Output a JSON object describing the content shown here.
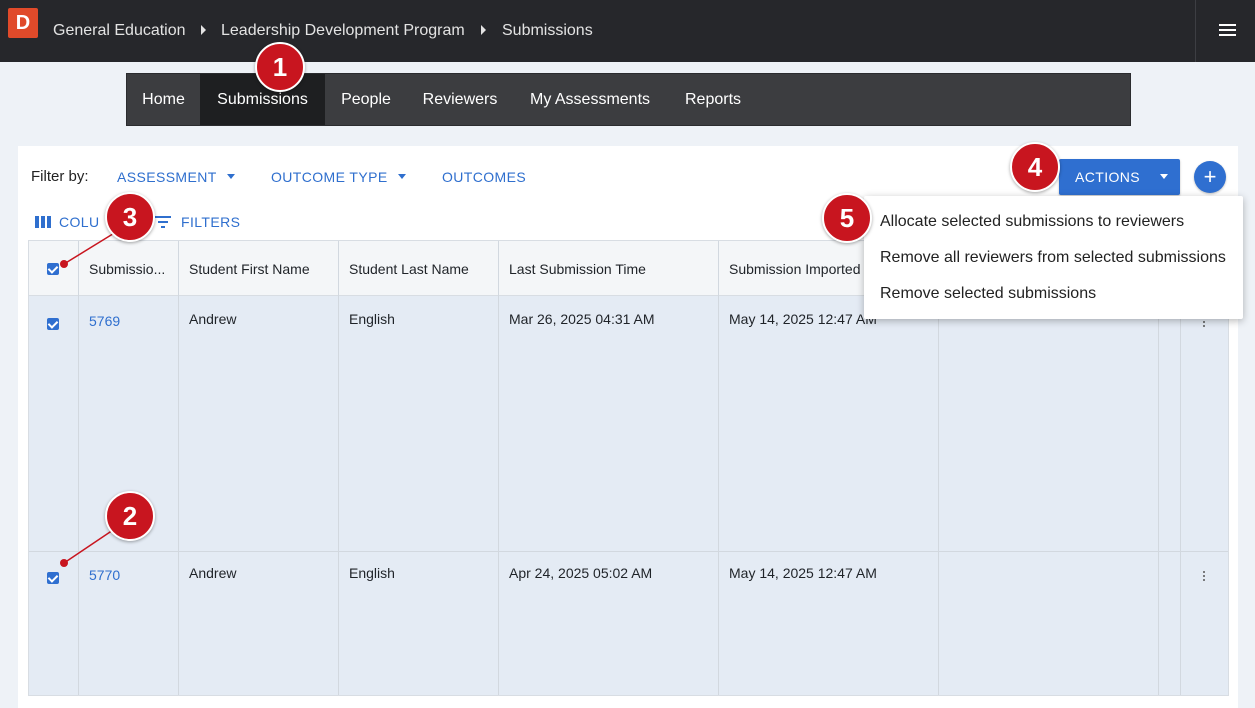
{
  "logo": "D",
  "breadcrumb": [
    "General Education",
    "Leadership Development Program",
    "Submissions"
  ],
  "nav": [
    "Home",
    "Submissions",
    "People",
    "Reviewers",
    "My Assessments",
    "Reports"
  ],
  "filters": {
    "label": "Filter by:",
    "assessment": "ASSESSMENT",
    "outcome_type": "OUTCOME TYPE",
    "outcomes": "OUTCOMES"
  },
  "toolbar": {
    "columns": "COLU",
    "filters": "FILTERS"
  },
  "actions": {
    "label": "ACTIONS",
    "add": "+"
  },
  "menu": [
    "Allocate selected submissions to reviewers",
    "Remove all reviewers from selected submissions",
    "Remove selected submissions"
  ],
  "table": {
    "headers": [
      "Submissio...",
      "Student First Name",
      "Student Last Name",
      "Last Submission Time",
      "Submission Imported"
    ],
    "rows": [
      {
        "id": "5769",
        "first": "Andrew",
        "last": "English",
        "submitted": "Mar 26, 2025 04:31 AM",
        "imported": "May 14, 2025 12:47 AM",
        "selected": true
      },
      {
        "id": "5770",
        "first": "Andrew",
        "last": "English",
        "submitted": "Apr 24, 2025 05:02 AM",
        "imported": "May 14, 2025 12:47 AM",
        "selected": true
      }
    ]
  },
  "callouts": [
    "1",
    "2",
    "3",
    "4",
    "5"
  ],
  "colors": {
    "accent": "#2f6fd0",
    "topbar": "#26272b",
    "callout": "#c8151f"
  }
}
